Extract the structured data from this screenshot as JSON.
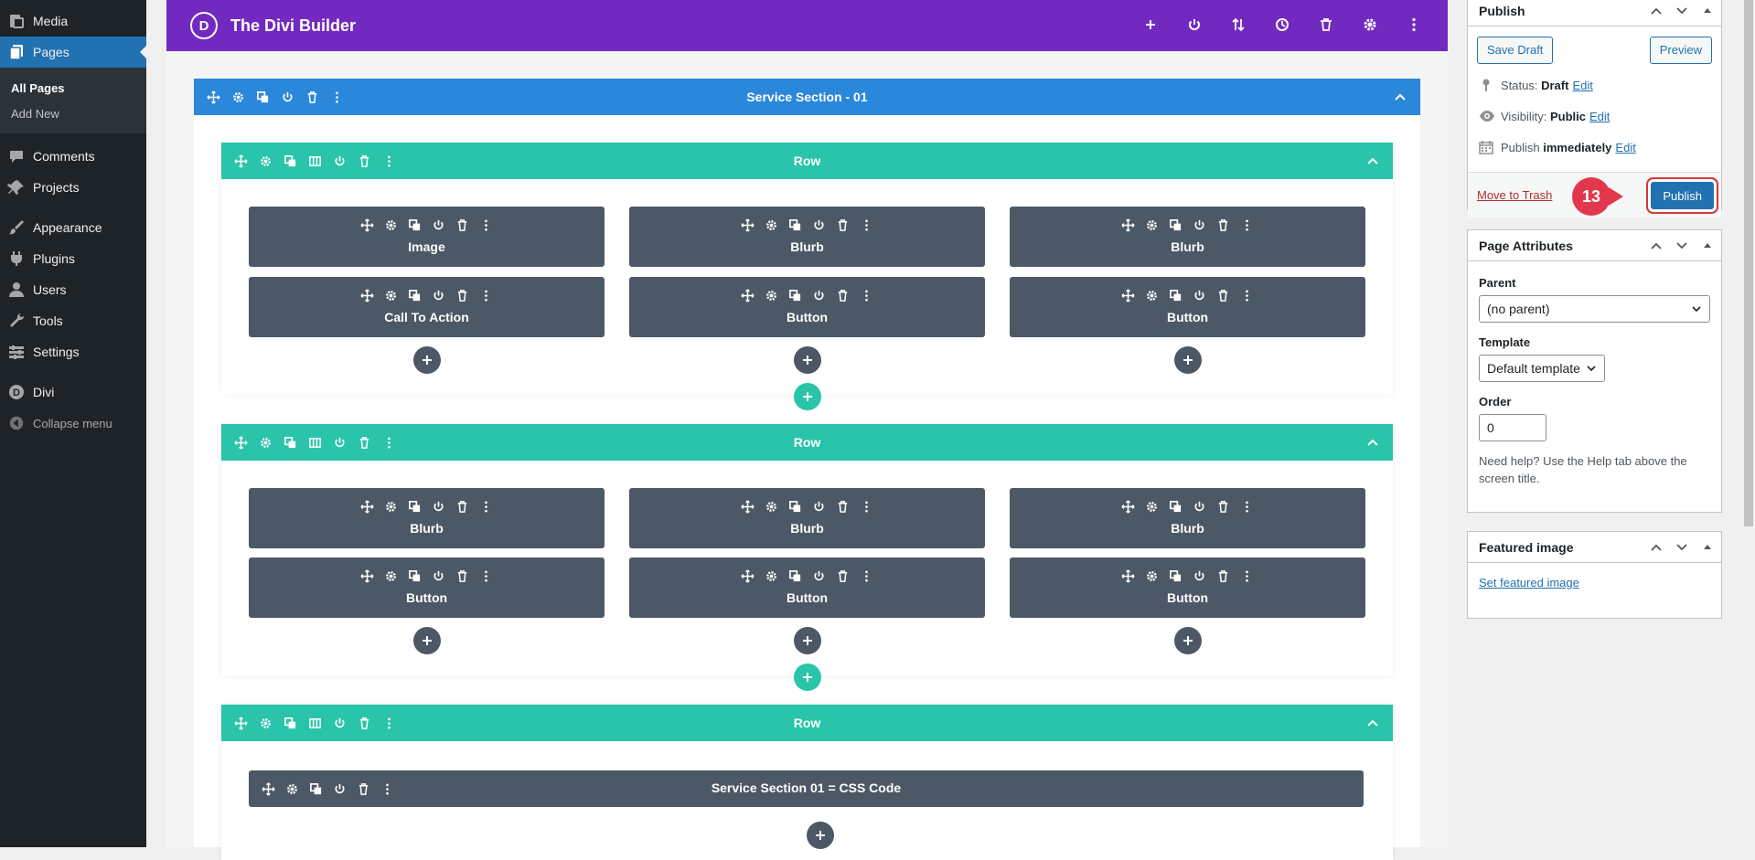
{
  "adminmenu": {
    "items": [
      {
        "label": "Media",
        "icon": "media-icon"
      },
      {
        "label": "Pages",
        "icon": "pages-icon"
      },
      {
        "label": "Comments",
        "icon": "comments-icon"
      },
      {
        "label": "Projects",
        "icon": "projects-icon"
      },
      {
        "label": "Appearance",
        "icon": "appearance-icon"
      },
      {
        "label": "Plugins",
        "icon": "plugins-icon"
      },
      {
        "label": "Users",
        "icon": "users-icon"
      },
      {
        "label": "Tools",
        "icon": "tools-icon"
      },
      {
        "label": "Settings",
        "icon": "settings-icon"
      },
      {
        "label": "Divi",
        "icon": "divi-icon"
      }
    ],
    "submenu": [
      "All Pages",
      "Add New"
    ],
    "collapse": "Collapse menu"
  },
  "builder": {
    "logo": "D",
    "title": "The Divi Builder",
    "section_title": "Service Section - 01",
    "row_title": "Row",
    "rows": [
      {
        "modules": [
          "Image",
          "Blurb",
          "Blurb",
          "Call To Action",
          "Button",
          "Button"
        ]
      },
      {
        "modules": [
          "Blurb",
          "Blurb",
          "Blurb",
          "Button",
          "Button",
          "Button"
        ]
      },
      {
        "modules": [
          "Service Section 01 = CSS Code"
        ]
      }
    ]
  },
  "publish": {
    "title": "Publish",
    "save_draft": "Save Draft",
    "preview": "Preview",
    "status_label": "Status:",
    "status_value": "Draft",
    "visibility_label": "Visibility:",
    "visibility_value": "Public",
    "publish_label": "Publish",
    "publish_value": "immediately",
    "edit": "Edit",
    "trash": "Move to Trash",
    "publish_button": "Publish",
    "step": "13"
  },
  "attributes": {
    "title": "Page Attributes",
    "parent_label": "Parent",
    "parent_value": "(no parent)",
    "template_label": "Template",
    "template_value": "Default template",
    "order_label": "Order",
    "order_value": "0",
    "help": "Need help? Use the Help tab above the screen title."
  },
  "featured": {
    "title": "Featured image",
    "link": "Set featured image"
  },
  "colors": {
    "admin_bg": "#1d2327",
    "admin_current": "#2271b1",
    "divi_purple": "#7229c0",
    "section_blue": "#2b87da",
    "row_teal": "#29c4a9",
    "module_gray": "#4c5866",
    "step_red": "#e2384d"
  }
}
